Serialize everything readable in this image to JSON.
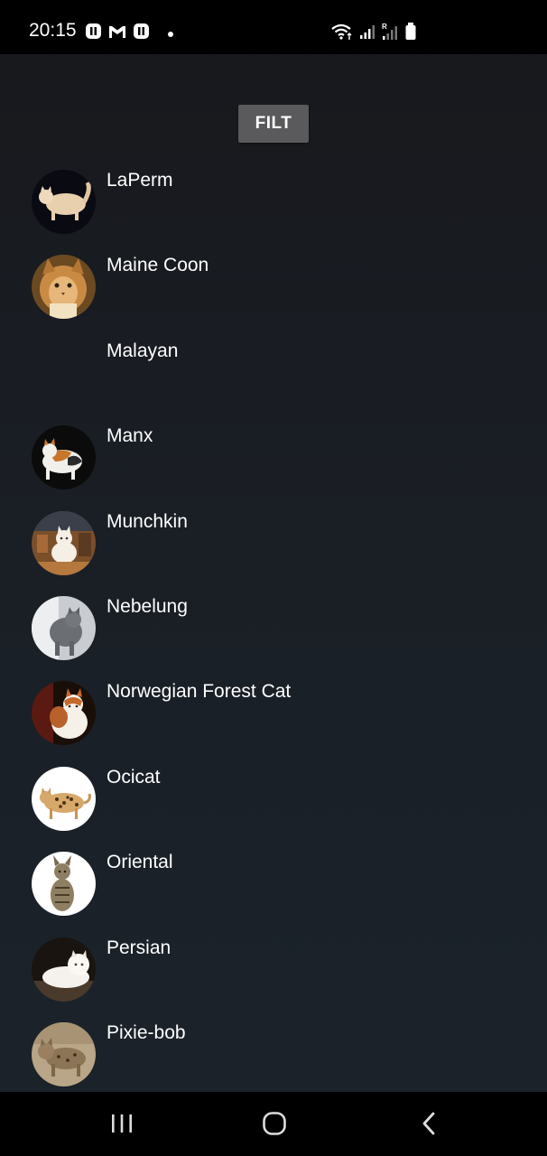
{
  "status_bar": {
    "time": "20:15",
    "notification_icons": [
      "notification-app-icon",
      "gmail-icon",
      "notification-app-icon",
      "dot-icon"
    ],
    "system_icons": [
      "wifi-icon",
      "signal-icon",
      "signal-roaming-icon",
      "battery-icon"
    ]
  },
  "filter_button": {
    "label": "FILT"
  },
  "breeds": [
    {
      "name": "LaPerm",
      "avatar": "cat-photo-laperm",
      "has_image": true
    },
    {
      "name": "Maine Coon",
      "avatar": "cat-photo-maine-coon",
      "has_image": true
    },
    {
      "name": "Malayan",
      "avatar": "",
      "has_image": false
    },
    {
      "name": "Manx",
      "avatar": "cat-photo-manx",
      "has_image": true
    },
    {
      "name": "Munchkin",
      "avatar": "cat-photo-munchkin",
      "has_image": true
    },
    {
      "name": "Nebelung",
      "avatar": "cat-photo-nebelung",
      "has_image": true
    },
    {
      "name": "Norwegian Forest Cat",
      "avatar": "cat-photo-norwegian-forest-cat",
      "has_image": true
    },
    {
      "name": "Ocicat",
      "avatar": "cat-photo-ocicat",
      "has_image": true
    },
    {
      "name": "Oriental",
      "avatar": "cat-photo-oriental",
      "has_image": true
    },
    {
      "name": "Persian",
      "avatar": "cat-photo-persian",
      "has_image": true
    },
    {
      "name": "Pixie-bob",
      "avatar": "cat-photo-pixie-bob",
      "has_image": true
    }
  ],
  "nav_bar": {
    "buttons": [
      "recent-apps-icon",
      "home-icon",
      "back-icon"
    ]
  }
}
